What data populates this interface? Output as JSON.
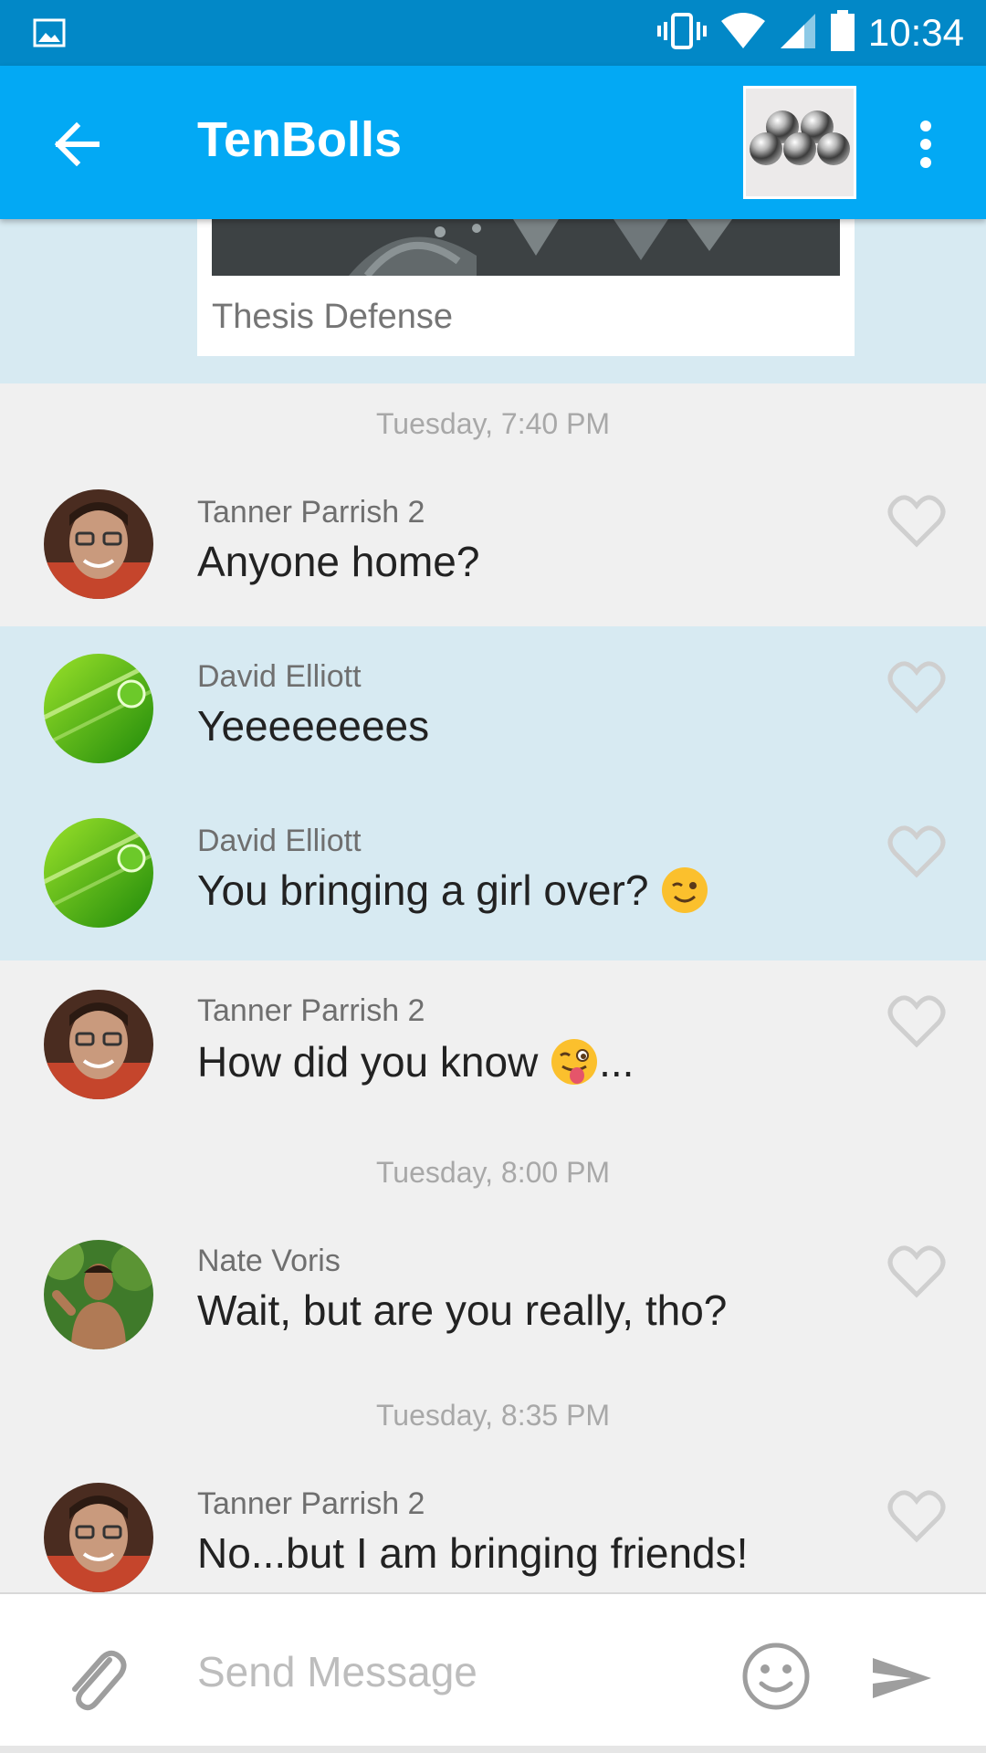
{
  "status_bar": {
    "time": "10:34",
    "icons": [
      "image-notification-icon",
      "vibrate-icon",
      "wifi-icon",
      "signal-icon",
      "battery-icon"
    ]
  },
  "app_bar": {
    "title": "TenBolls",
    "back_icon": "arrow-back-icon",
    "more_icon": "more-vert-icon"
  },
  "shared_card": {
    "caption": "Thesis Defense"
  },
  "timestamps": [
    "Tuesday, 7:40 PM",
    "Tuesday, 8:00 PM",
    "Tuesday, 8:35 PM"
  ],
  "messages": [
    {
      "sender": "Tanner Parrish 2",
      "text": "Anyone home?",
      "emoji": "",
      "suffix": ""
    },
    {
      "sender": "David Elliott",
      "text": "Yeeeeeeees",
      "emoji": "",
      "suffix": ""
    },
    {
      "sender": "David Elliott",
      "text": "You bringing a girl over? ",
      "emoji": "wink-emoji",
      "suffix": ""
    },
    {
      "sender": "Tanner Parrish 2",
      "text": "How did you know ",
      "emoji": "tongue-wink-emoji",
      "suffix": "..."
    },
    {
      "sender": "Nate Voris",
      "text": "Wait, but are you really, tho?",
      "emoji": "",
      "suffix": ""
    },
    {
      "sender": "Tanner Parrish 2",
      "text": "No...but I am bringing friends!",
      "emoji": "",
      "suffix": ""
    }
  ],
  "composer": {
    "placeholder": "Send Message",
    "attach_icon": "paperclip-icon",
    "emoji_icon": "smiley-icon",
    "send_icon": "send-icon"
  },
  "colors": {
    "status_bar": "#0288c7",
    "app_bar": "#03a9f4",
    "highlight_row": "#d7eaf2",
    "background": "#f0f0f0"
  }
}
